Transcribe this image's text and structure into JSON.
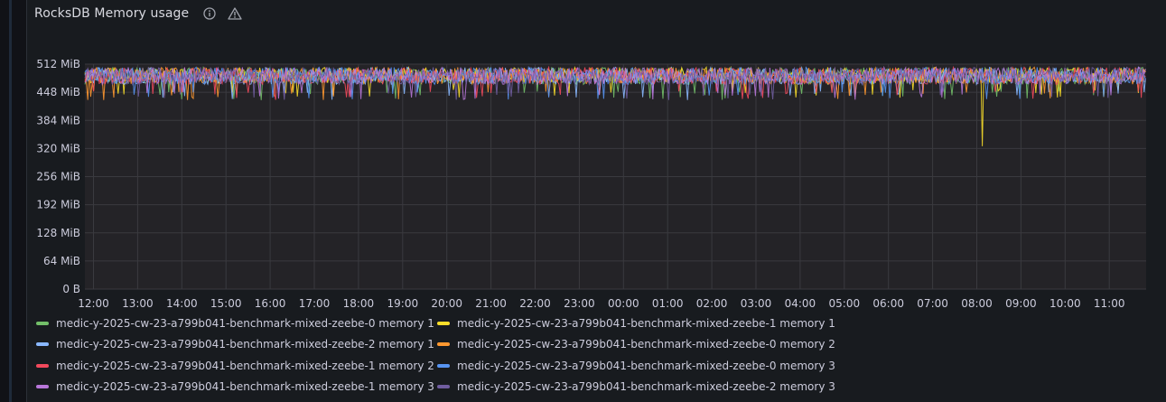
{
  "panel": {
    "title": "RocksDB Memory usage",
    "info_icon": "info-circle-icon",
    "warning_icon": "warning-triangle-icon"
  },
  "chart_data": {
    "type": "line",
    "title": "RocksDB Memory usage",
    "xlabel": "",
    "ylabel": "",
    "ylim": [
      0,
      512
    ],
    "yticks": [
      {
        "value": 512,
        "label": "512 MiB"
      },
      {
        "value": 448,
        "label": "448 MiB"
      },
      {
        "value": 384,
        "label": "384 MiB"
      },
      {
        "value": 320,
        "label": "320 MiB"
      },
      {
        "value": 256,
        "label": "256 MiB"
      },
      {
        "value": 192,
        "label": "192 MiB"
      },
      {
        "value": 128,
        "label": "128 MiB"
      },
      {
        "value": 64,
        "label": "64 MiB"
      },
      {
        "value": 0,
        "label": "0 B"
      }
    ],
    "xlim": [
      "12:00",
      "11:53"
    ],
    "xticks": [
      "12:00",
      "13:00",
      "14:00",
      "15:00",
      "16:00",
      "17:00",
      "18:00",
      "19:00",
      "20:00",
      "21:00",
      "22:00",
      "23:00",
      "00:00",
      "01:00",
      "02:00",
      "03:00",
      "04:00",
      "05:00",
      "06:00",
      "07:00",
      "08:00",
      "09:00",
      "10:00",
      "11:00"
    ],
    "grid": true,
    "legend_position": "bottom",
    "series": [
      {
        "name": "medic-y-2025-cw-23-a799b041-benchmark-mixed-zeebe-0 memory 1",
        "color": "#73bf69",
        "values": {
          "band": [
            445,
            505
          ]
        }
      },
      {
        "name": "medic-y-2025-cw-23-a799b041-benchmark-mixed-zeebe-1 memory 1",
        "color": "#fade2a",
        "values": {
          "band": [
            450,
            505
          ],
          "dip": {
            "time": "08:07",
            "value": 325
          }
        }
      },
      {
        "name": "medic-y-2025-cw-23-a799b041-benchmark-mixed-zeebe-2 memory 1",
        "color": "#8ab8ff",
        "values": {
          "band": [
            445,
            505
          ]
        }
      },
      {
        "name": "medic-y-2025-cw-23-a799b041-benchmark-mixed-zeebe-0 memory 2",
        "color": "#ff9830",
        "values": {
          "band": [
            445,
            505
          ]
        }
      },
      {
        "name": "medic-y-2025-cw-23-a799b041-benchmark-mixed-zeebe-1 memory 2",
        "color": "#f2495c",
        "values": {
          "band": [
            445,
            505
          ]
        }
      },
      {
        "name": "medic-y-2025-cw-23-a799b041-benchmark-mixed-zeebe-0 memory 3",
        "color": "#5794f2",
        "values": {
          "band": [
            445,
            505
          ]
        }
      },
      {
        "name": "medic-y-2025-cw-23-a799b041-benchmark-mixed-zeebe-1 memory 3",
        "color": "#b877d9",
        "values": {
          "band": [
            445,
            505
          ]
        }
      },
      {
        "name": "medic-y-2025-cw-23-a799b041-benchmark-mixed-zeebe-2 memory 3",
        "color": "#705da0",
        "values": {
          "band": [
            445,
            505
          ]
        }
      }
    ]
  }
}
